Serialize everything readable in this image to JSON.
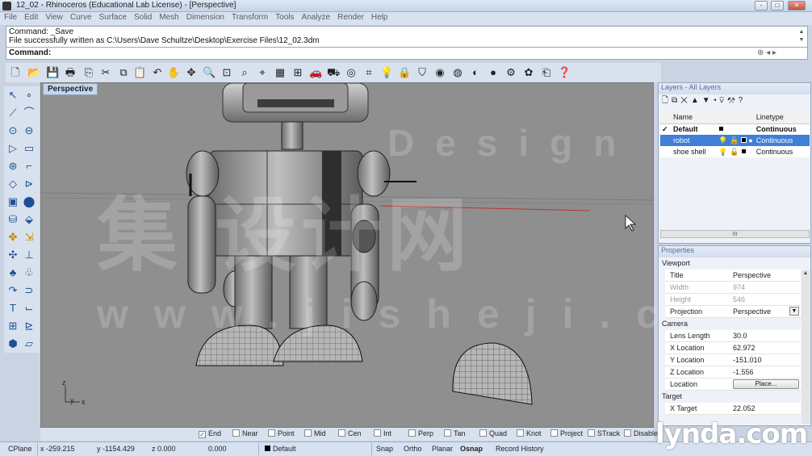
{
  "window": {
    "title": "12_02 - Rhinoceros (Educational Lab License) - [Perspective]",
    "buttons": [
      "-",
      "□",
      "✕"
    ]
  },
  "menu": [
    "File",
    "Edit",
    "View",
    "Curve",
    "Surface",
    "Solid",
    "Mesh",
    "Dimension",
    "Transform",
    "Tools",
    "Analyze",
    "Render",
    "Help"
  ],
  "command": {
    "history": [
      "Command: _Save",
      "File successfully written as C:\\Users\\Dave Schultze\\Desktop\\Exercise Files\\12_02.3dm"
    ],
    "prompt": "Command:"
  },
  "viewport": {
    "label": "Perspective",
    "axes": {
      "x": "x",
      "y": "y",
      "z": "z"
    }
  },
  "layers": {
    "title": "Layers - All Layers",
    "columns": [
      "Name",
      "Linetype"
    ],
    "rows": [
      {
        "check": "✓",
        "name": "Default",
        "linetype": "Continuous",
        "bold": true,
        "selected": false
      },
      {
        "check": "",
        "name": "robot",
        "linetype": "Continuous",
        "bold": false,
        "selected": true
      },
      {
        "check": "",
        "name": "shoe shell",
        "linetype": "Continuous",
        "bold": false,
        "selected": false
      }
    ],
    "scroll_label": "III"
  },
  "properties": {
    "title": "Properties",
    "section_viewport": "Viewport",
    "title_row": {
      "k": "Title",
      "v": "Perspective"
    },
    "width_row": {
      "k": "Width",
      "v": "974"
    },
    "height_row": {
      "k": "Height",
      "v": "546"
    },
    "projection_row": {
      "k": "Projection",
      "v": "Perspective"
    },
    "section_camera": "Camera",
    "lens_row": {
      "k": "Lens Length",
      "v": "30.0"
    },
    "xloc_row": {
      "k": "X Location",
      "v": "62.972"
    },
    "yloc_row": {
      "k": "Y Location",
      "v": "-151.010"
    },
    "zloc_row": {
      "k": "Z Location",
      "v": "-1.556"
    },
    "loc_row": {
      "k": "Location",
      "v": "Place..."
    },
    "section_target": "Target",
    "xtarget_row": {
      "k": "X Target",
      "v": "22.052"
    }
  },
  "osnap": [
    {
      "label": "End",
      "checked": true
    },
    {
      "label": "Near",
      "checked": false
    },
    {
      "label": "Point",
      "checked": false
    },
    {
      "label": "Mid",
      "checked": false
    },
    {
      "label": "Cen",
      "checked": false
    },
    {
      "label": "Int",
      "checked": false
    },
    {
      "label": "Perp",
      "checked": false
    },
    {
      "label": "Tan",
      "checked": false
    },
    {
      "label": "Quad",
      "checked": false
    },
    {
      "label": "Knot",
      "checked": false
    },
    {
      "label": "Project",
      "checked": false
    },
    {
      "label": "STrack",
      "checked": false
    },
    {
      "label": "Disable",
      "checked": false
    }
  ],
  "status": {
    "cplane": "CPlane",
    "x": "x -259.215",
    "y": "y -1154.429",
    "z": "z 0.000",
    "dist": "0.000",
    "layer": "Default",
    "snap": "Snap",
    "ortho": "Ortho",
    "planar": "Planar",
    "osnap": "Osnap",
    "record": "Record History"
  },
  "brand": "lynda.com",
  "watermarks": {
    "cn": "集 设计网",
    "en": "Design",
    "url": "www.jisheji.com"
  },
  "colors": {
    "selection": "#3f7fd8",
    "viewport_bg": "#8f8f8f",
    "chrome": "#d8e1ee"
  }
}
